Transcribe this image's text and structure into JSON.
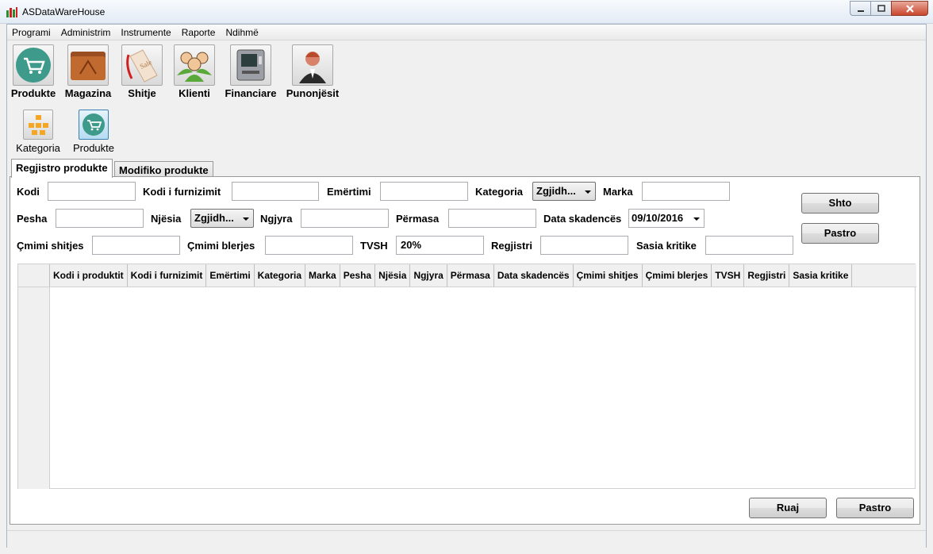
{
  "window": {
    "title": "ASDataWareHouse"
  },
  "menu": {
    "items": [
      "Programi",
      "Administrim",
      "Instrumente",
      "Raporte",
      "Ndihmë"
    ]
  },
  "toolbar": {
    "main": [
      "Produkte",
      "Magazina",
      "Shitje",
      "Klienti",
      "Financiare",
      "Punonjësit"
    ],
    "sub": [
      "Kategoria",
      "Produkte"
    ]
  },
  "tabs": [
    "Regjistro produkte",
    "Modifiko produkte"
  ],
  "form": {
    "kodi": "Kodi",
    "kodi_furnizimit": "Kodi i furnizimit",
    "emertimi": "Emërtimi",
    "kategoria": "Kategoria",
    "kategoria_value": "Zgjidh...",
    "marka": "Marka",
    "pesha": "Pesha",
    "njesia": "Njësia",
    "njesia_value": "Zgjidh...",
    "ngjyra": "Ngjyra",
    "permasa": "Përmasa",
    "data_skadences": "Data skadencës",
    "data_value": "09/10/2016",
    "cmimi_shitjes": "Çmimi shitjes",
    "cmimi_blerjes": "Çmimi blerjes",
    "tvsh": "TVSH",
    "tvsh_value": "20%",
    "regjistri": "Regjistri",
    "sasia_kritike": "Sasia kritike"
  },
  "buttons": {
    "shto": "Shto",
    "pastro": "Pastro",
    "ruaj": "Ruaj",
    "pastro2": "Pastro"
  },
  "grid": {
    "columns": [
      "Kodi i produktit",
      "Kodi i furnizimit",
      "Emërtimi",
      "Kategoria",
      "Marka",
      "Pesha",
      "Njësia",
      "Ngjyra",
      "Përmasa",
      "Data skadencës",
      "Çmimi shitjes",
      "Çmimi blerjes",
      "TVSH",
      "Regjistri",
      "Sasia kritike"
    ]
  }
}
